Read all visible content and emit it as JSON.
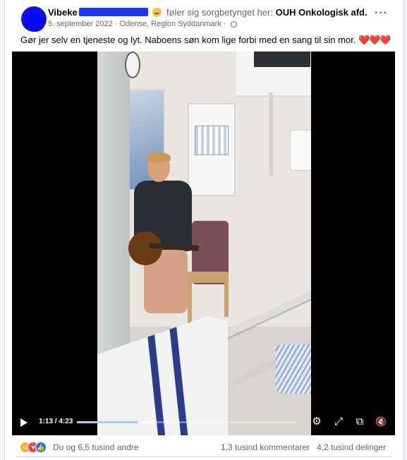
{
  "post": {
    "author_visible": "Vibeke",
    "feeling_text": "føler sig sorgbetynget her:",
    "place": "OUH Onkologisk afd.",
    "date": "5. september 2022",
    "location": "Odense, Region Syddanmark",
    "separator": "·",
    "more_label": "···",
    "caption": "Gør jer selv en tjeneste og lyt. Naboens søn kom lige forbi med en sang til sin mor.",
    "caption_hearts": "❤️❤️❤️"
  },
  "video": {
    "current_time": "1:13",
    "duration": "4:23",
    "time_display": "1:13 / 4:23",
    "progress": 0.28,
    "buffered": 0.36,
    "icons": {
      "play": "play-icon",
      "settings": "gear-icon",
      "expand": "expand-icon",
      "pip": "picture-in-picture-icon",
      "mute": "speaker-muted-icon"
    },
    "settings_glyph": "⚙",
    "expand_glyph": "⤢",
    "pip_glyph": "⧉",
    "mute_glyph": "🔇"
  },
  "stats": {
    "reactions_label": "Du og 6,5 tusind andre",
    "comments_label": "1,3 tusind kommentarer",
    "shares_label": "4,2 tusind delinger",
    "reaction_icons": [
      "care-reaction-icon",
      "love-reaction-icon",
      "like-reaction-icon"
    ]
  },
  "colors": {
    "accent": "#1877f2",
    "progress": "#3b8ff3",
    "text_secondary": "#65676b"
  }
}
